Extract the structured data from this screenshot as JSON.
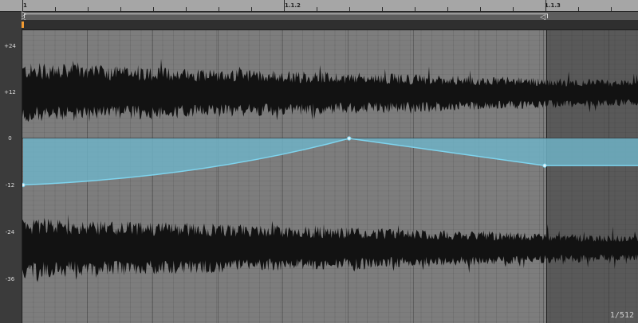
{
  "ruler": {
    "bars": [
      {
        "label": "1",
        "beat": 0
      },
      {
        "label": "1.1.2",
        "beat": 1
      },
      {
        "label": "1.1.3",
        "beat": 2
      }
    ]
  },
  "gain_scale": [
    "+24",
    "+12",
    "0",
    "-12",
    "-24",
    "-36"
  ],
  "zoom": "1/512",
  "colors": {
    "playhead": "#f29b32",
    "envelope_line": "#7ed4ee",
    "envelope_fill": "#6fb2c6",
    "waveform": "#121212",
    "editor_bg": "#7d7d7d"
  },
  "envelope": {
    "units": "dB",
    "breakpoints": [
      {
        "beat": 0.0,
        "db": -12
      },
      {
        "beat": 1.25,
        "db": 0
      },
      {
        "beat": 2.0,
        "db": -7
      },
      {
        "beat": 2.4,
        "db": -7
      }
    ]
  }
}
